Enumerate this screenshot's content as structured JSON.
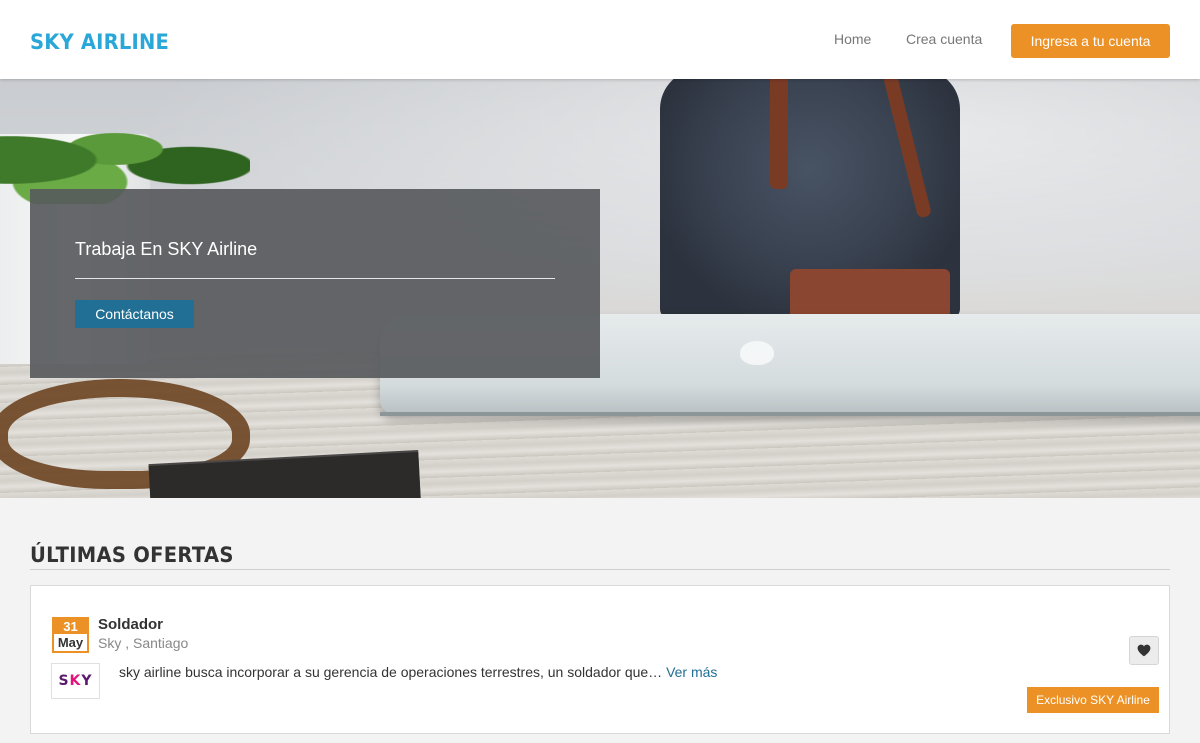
{
  "header": {
    "brand": "SKY AIRLINE",
    "nav": {
      "home": "Home",
      "create_account": "Crea cuenta",
      "login": "Ingresa a tu cuenta"
    }
  },
  "hero": {
    "title": "Trabaja En SKY Airline",
    "cta": "Contáctanos"
  },
  "offers": {
    "section_title": "ÚLTIMAS OFERTAS",
    "jobs": [
      {
        "day": "31",
        "month": "May",
        "title": "Soldador",
        "meta": "Sky , Santiago",
        "logo_text": "SKY",
        "description": "sky airline busca incorporar a su gerencia de operaciones terrestres, un soldador que…",
        "more_link": "Ver más",
        "badge": "Exclusivo SKY Airline",
        "favorite_icon": "heart-icon"
      }
    ]
  },
  "colors": {
    "brand": "#2aa7d9",
    "accent_orange": "#ec9126",
    "cta_blue": "#216f94",
    "logo_purple": "#5b1a6e",
    "logo_pink": "#e2127a"
  }
}
